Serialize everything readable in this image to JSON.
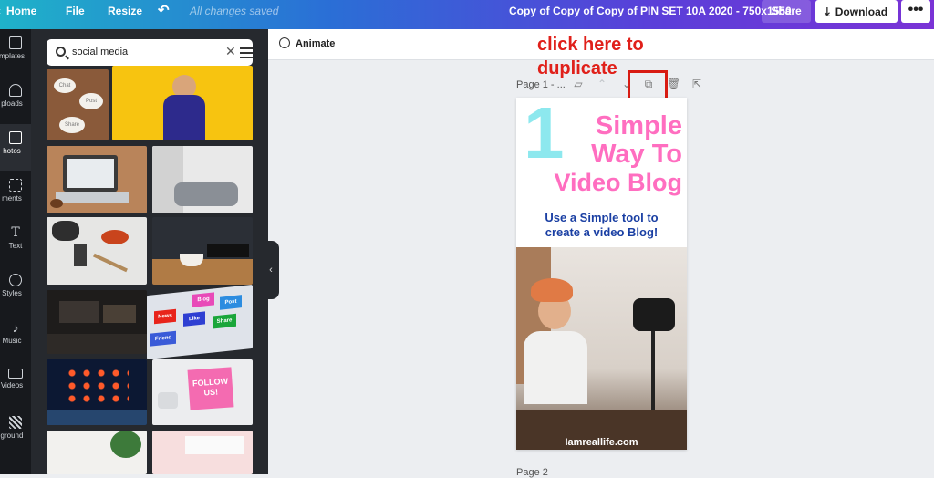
{
  "topbar": {
    "home": "Home",
    "file": "File",
    "resize": "Resize",
    "undo_icon": "undo-icon",
    "save_status": "All changes saved",
    "doc_title": "Copy of Copy of Copy of  PIN SET 10A 2020 - 750x1550",
    "share": "Share",
    "download": "Download",
    "more": "•••"
  },
  "rail": [
    {
      "label": "mplates",
      "icon": "templates-icon"
    },
    {
      "label": "ploads",
      "icon": "uploads-icon"
    },
    {
      "label": "hotos",
      "icon": "photos-icon",
      "active": true
    },
    {
      "label": "ments",
      "icon": "elements-icon"
    },
    {
      "label": "Text",
      "icon": "text-icon"
    },
    {
      "label": "Styles",
      "icon": "styles-icon"
    },
    {
      "label": "Music",
      "icon": "music-icon"
    },
    {
      "label": "Videos",
      "icon": "videos-icon"
    },
    {
      "label": "ground",
      "icon": "background-icon"
    }
  ],
  "search": {
    "value": "social media"
  },
  "thumb_texts": {
    "tile1_words": [
      "Chat",
      "Post",
      "Share"
    ],
    "keyboard": [
      "Blog",
      "Post",
      "News",
      "Like",
      "Share",
      "Friend"
    ],
    "follow": "FOLLOW US!"
  },
  "editor": {
    "animate": "Animate",
    "annotation_line1": "click here to",
    "annotation_line2": "duplicate",
    "page1_label": "Page 1 - ...",
    "page2_label": "Page 2"
  },
  "pin": {
    "big_number": "1",
    "title_lines": [
      "Simple",
      "Way To",
      "Video Blog"
    ],
    "subtitle_lines": [
      "Use a Simple tool to",
      "create a video Blog!"
    ],
    "url": "Iamreallife.com"
  },
  "colors": {
    "annotation": "#e0201a",
    "pin_title": "#ff6ec0",
    "pin_number": "#8de8ee",
    "pin_subtitle": "#1a3fa3"
  }
}
